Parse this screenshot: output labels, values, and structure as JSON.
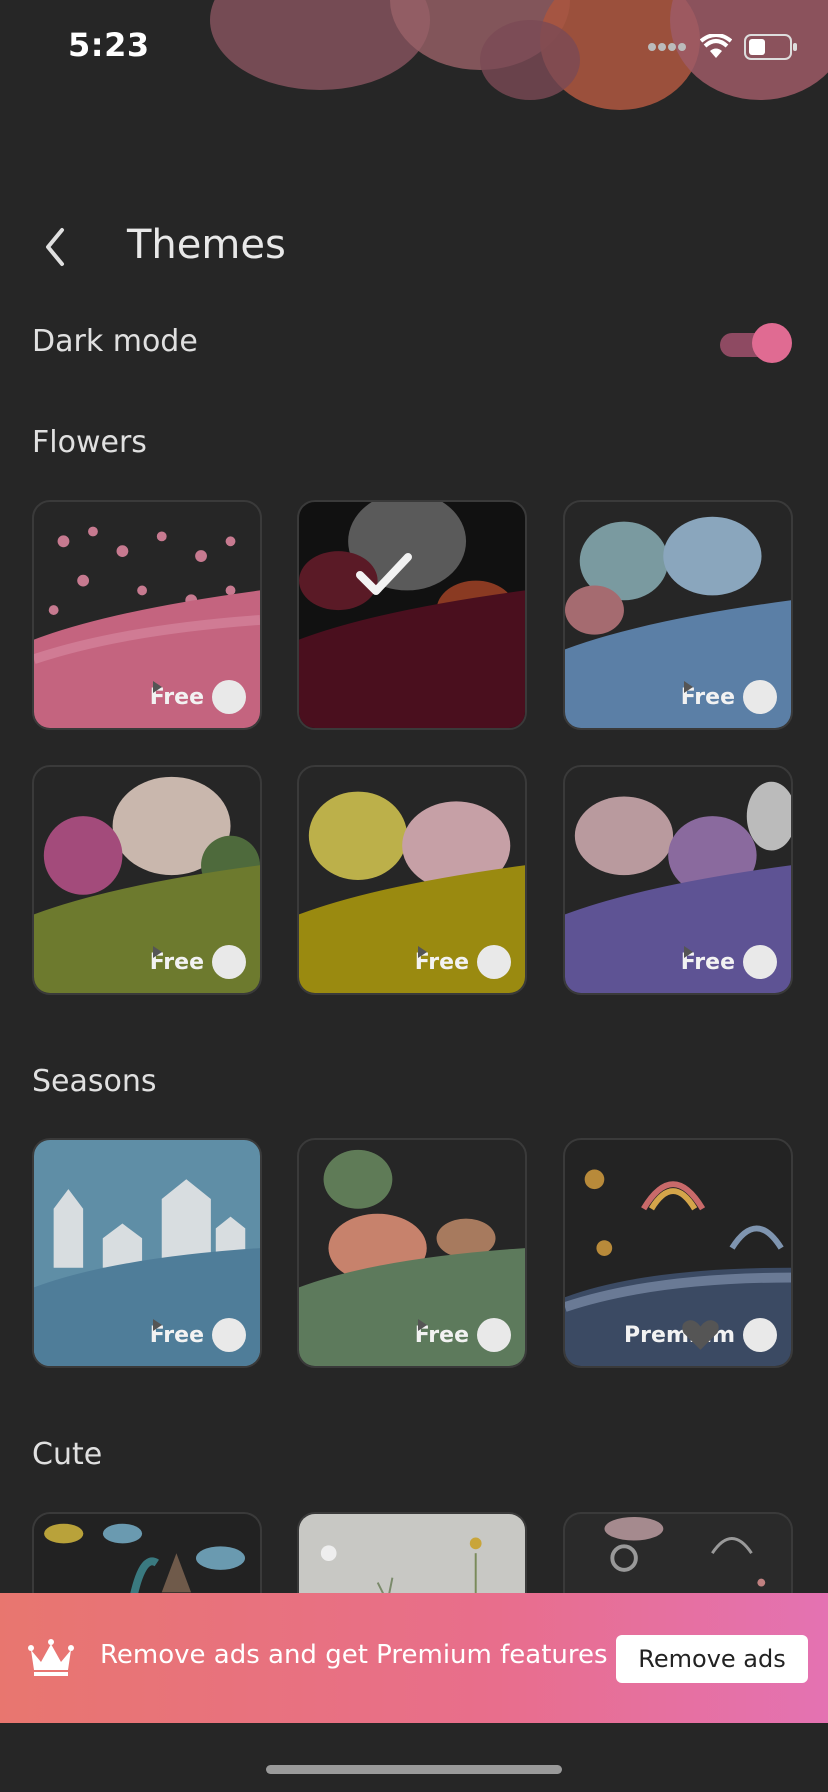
{
  "status_bar": {
    "time": "5:23"
  },
  "header": {
    "title": "Themes"
  },
  "dark_mode": {
    "label": "Dark mode",
    "enabled": true
  },
  "sections": {
    "flowers": {
      "title": "Flowers",
      "cards": [
        {
          "badge": "Free",
          "color": "#c4647f"
        },
        {
          "badge": "",
          "selected": true,
          "color": "#4a0f1e"
        },
        {
          "badge": "Free",
          "color": "#5b7fa6"
        },
        {
          "badge": "Free",
          "color": "#6d7a2e"
        },
        {
          "badge": "Free",
          "color": "#9a8a10"
        },
        {
          "badge": "Free",
          "color": "#5e5394"
        }
      ]
    },
    "seasons": {
      "title": "Seasons",
      "cards": [
        {
          "badge": "Free",
          "color": "#4f7d99"
        },
        {
          "badge": "Free",
          "color": "#5d7a5c"
        },
        {
          "badge": "Premium",
          "color": "#3b4a63"
        }
      ]
    },
    "cute": {
      "title": "Cute"
    }
  },
  "banner": {
    "text": "Remove ads and get Premium features",
    "button": "Remove ads"
  },
  "colors": {
    "accent": "#e06b92",
    "background": "#262626"
  }
}
